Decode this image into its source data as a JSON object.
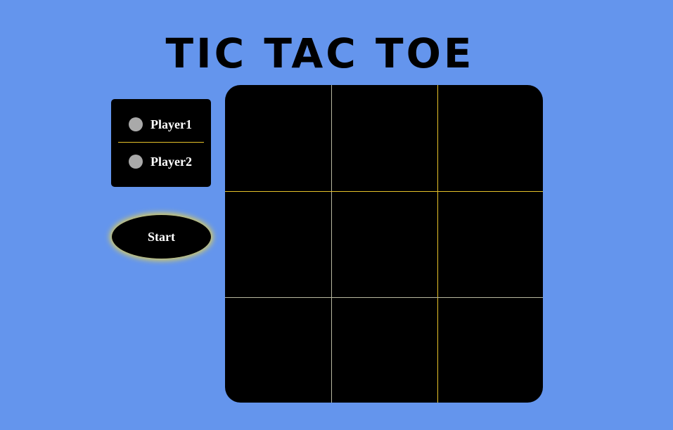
{
  "title": "TIC TAC TOE",
  "players": [
    {
      "label": "Player1",
      "indicator_color": "#a9a9a9"
    },
    {
      "label": "Player2",
      "indicator_color": "#a9a9a9"
    }
  ],
  "start_button": {
    "label": "Start"
  },
  "board": {
    "cells": [
      "",
      "",
      "",
      "",
      "",
      "",
      "",
      "",
      ""
    ],
    "line_colors": {
      "yellow": "#e6c229",
      "gray": "#b8b8a0"
    }
  },
  "colors": {
    "background": "#6495ED",
    "panel": "#000000",
    "glow": "#d8cc60"
  }
}
